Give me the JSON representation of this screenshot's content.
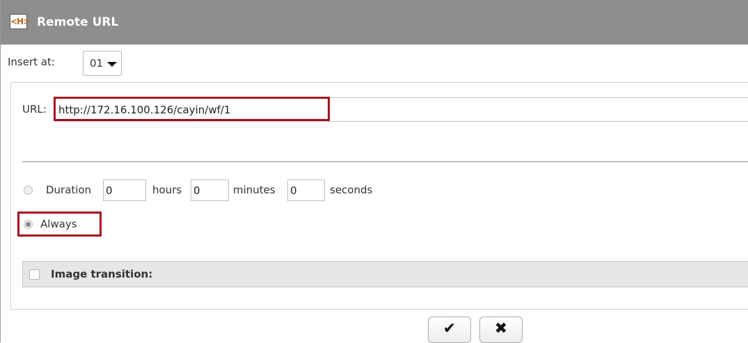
{
  "dialog": {
    "title": "Remote URL",
    "icon": "html-file-icon"
  },
  "insert": {
    "label": "Insert at:",
    "value": "01"
  },
  "url": {
    "label": "URL:",
    "value": "http://172.16.100.126/cayin/wf/1"
  },
  "duration": {
    "label": "Duration",
    "hours_value": "0",
    "hours_label": "hours",
    "minutes_value": "0",
    "minutes_label": "minutes",
    "seconds_value": "0",
    "seconds_label": "seconds",
    "selected": false
  },
  "always": {
    "label": "Always",
    "selected": true
  },
  "transition": {
    "label": "Image transition:",
    "checked": false
  },
  "buttons": {
    "confirm_glyph": "✔",
    "cancel_glyph": "✖"
  },
  "colors": {
    "highlight": "#a1141d",
    "titlebar": "#8b8b8b"
  }
}
